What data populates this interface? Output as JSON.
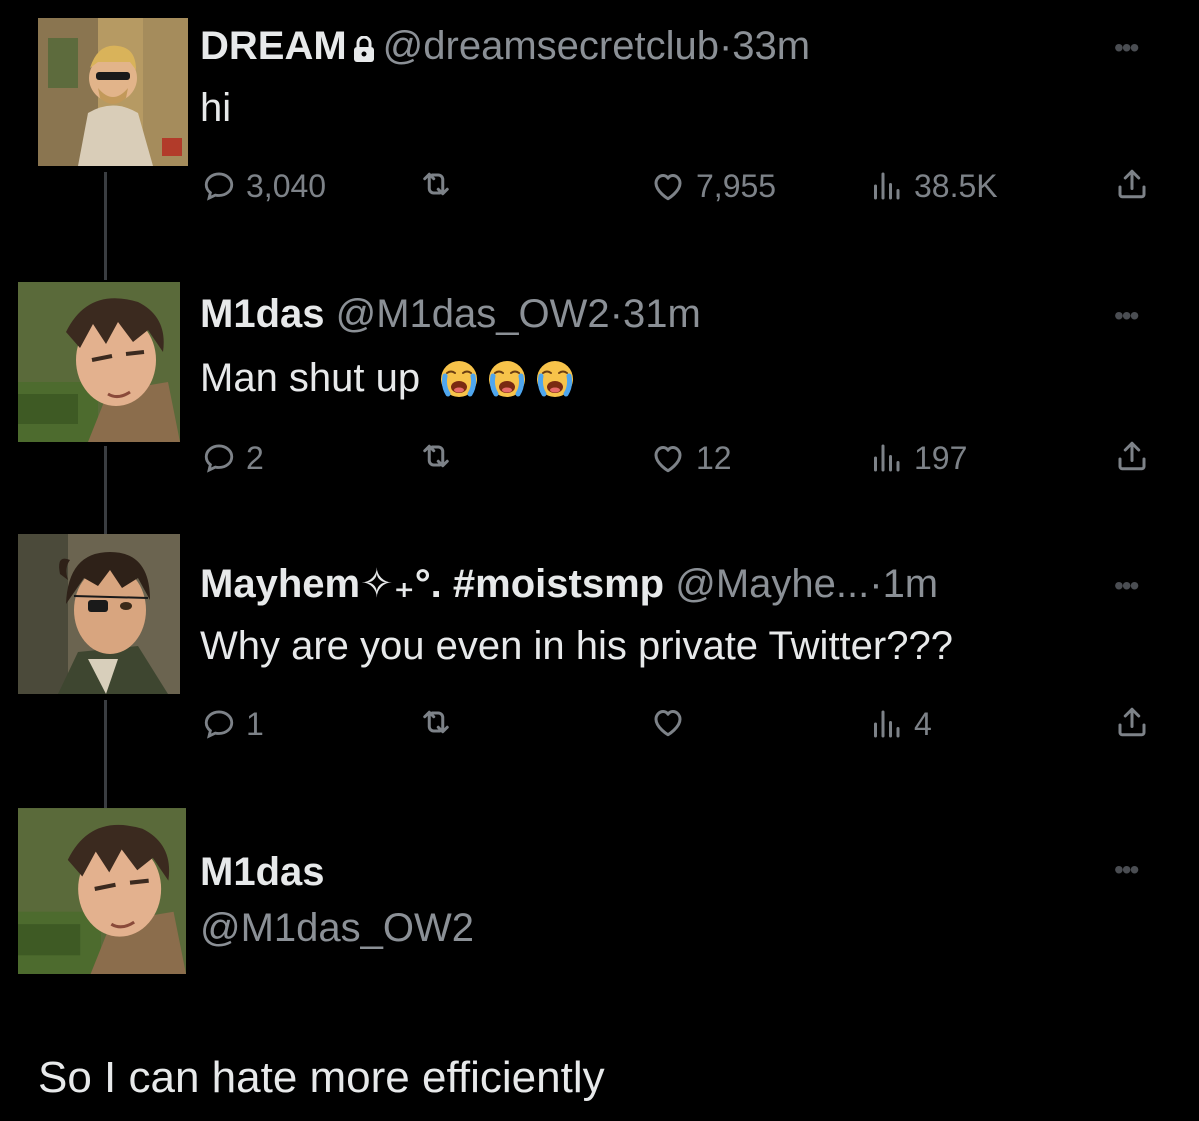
{
  "tweets": [
    {
      "name": "DREAM",
      "locked": true,
      "handle": "@dreamsecretclub",
      "separator": "·",
      "time": "33m",
      "text": "hi",
      "replies": "3,040",
      "retweets": "",
      "likes": "7,955",
      "views": "38.5K"
    },
    {
      "name": "M1das",
      "handle": "@M1das_OW2",
      "separator": "·",
      "time": "31m",
      "text": "Man shut up",
      "emoji_count": 3,
      "emoji_name": "loudly-crying-face",
      "replies": "2",
      "retweets": "",
      "likes": "12",
      "views": "197"
    },
    {
      "name": "Mayhem✧₊°. #moistsmp",
      "handle": "@Mayhe...",
      "separator": "·",
      "time": "1m",
      "text": "Why are you even in his private Twitter???",
      "replies": "1",
      "retweets": "",
      "likes": "",
      "views": "4"
    }
  ],
  "reply_author": {
    "name": "M1das",
    "handle": "@M1das_OW2"
  },
  "reply_text": "So I can hate more efficiently",
  "colors": {
    "background": "#000000",
    "text": "#e7e9ea",
    "muted": "#7d8288",
    "thread_line": "#3a3d41"
  },
  "icons": [
    "lock-icon",
    "more-icon",
    "reply-icon",
    "retweet-icon",
    "like-icon",
    "views-icon",
    "share-icon",
    "crying-face-emoji"
  ]
}
